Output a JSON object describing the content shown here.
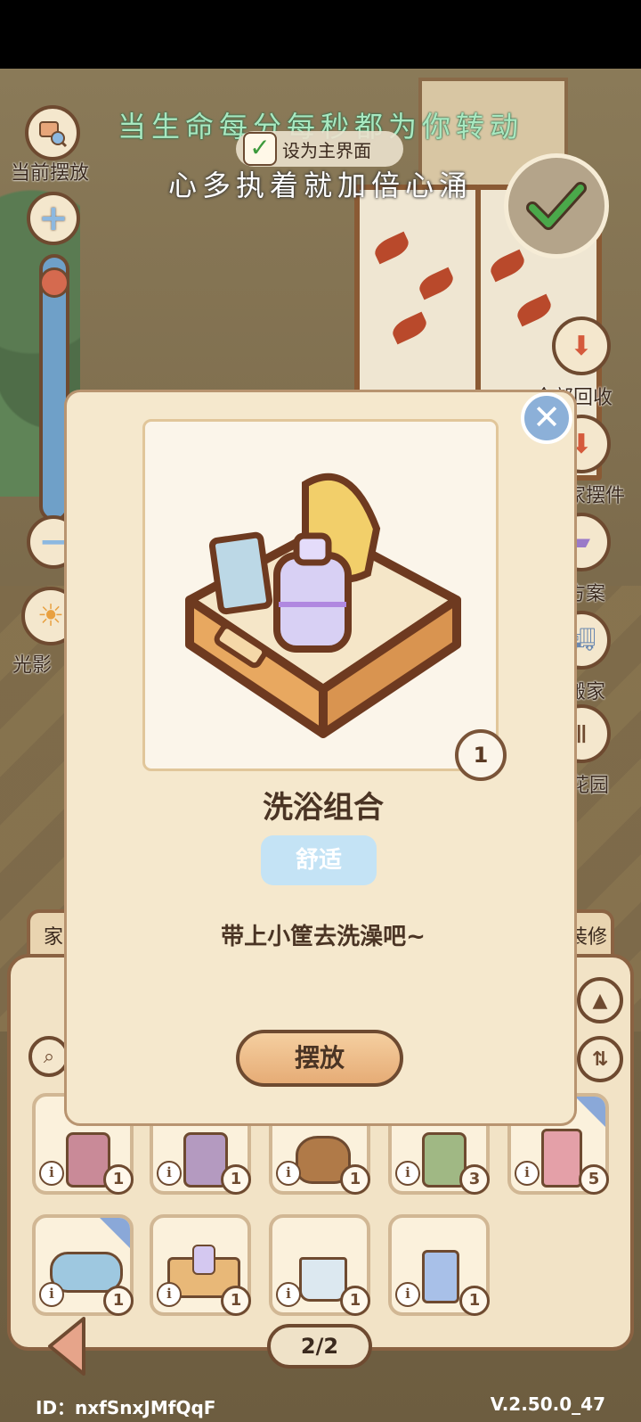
{
  "overlay_lyrics": {
    "line1": "当生命每分每秒都为你转动",
    "line2": "心多执着就加倍心涌"
  },
  "top_controls": {
    "current_placement_label": "当前摆放",
    "set_main_screen_label": "设为主界面",
    "light_label": "光影"
  },
  "right_menu": {
    "recycle_all_label": "全部回收",
    "furniture_parts_label": "家摆件",
    "plans_label": "方案",
    "move_label": "搬家",
    "garden_label": "花园"
  },
  "bottom_tabs": {
    "left_tab": "家",
    "right_tab": "装修"
  },
  "modal": {
    "item_name": "洗浴组合",
    "tag": "舒适",
    "description": "带上小筐去洗澡吧~",
    "quantity": "1",
    "place_button": "摆放",
    "close_symbol": "✕"
  },
  "inventory": {
    "info_symbol": "i",
    "row1": [
      {
        "name": "pink-jar",
        "count": "1"
      },
      {
        "name": "purple-jar",
        "count": "1"
      },
      {
        "name": "bear-cup",
        "count": "1"
      },
      {
        "name": "green-jar",
        "count": "3"
      },
      {
        "name": "pink-bottle",
        "count": "5"
      }
    ],
    "row2": [
      {
        "name": "soap-dish",
        "count": "1"
      },
      {
        "name": "bath-basket",
        "count": "1"
      },
      {
        "name": "brush-cup",
        "count": "1"
      },
      {
        "name": "toothbrush-cup",
        "count": "1"
      }
    ]
  },
  "pagination": {
    "page": "2/2"
  },
  "footer": {
    "id": "ID：nxfSnxJMfQqF",
    "version": "V.2.50.0_47"
  },
  "colors": {
    "panel_bg": "#f5e8cd",
    "border_brown": "#6e4a30",
    "tag_blue": "#c4e3f5",
    "confirm_green": "#4aa84a"
  }
}
